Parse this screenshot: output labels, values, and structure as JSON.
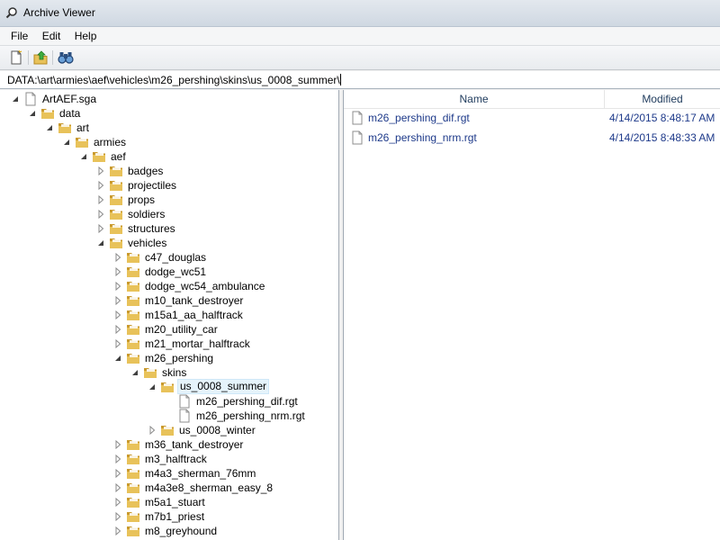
{
  "window": {
    "title": "Archive Viewer"
  },
  "menu": [
    "File",
    "Edit",
    "Help"
  ],
  "toolbar": {
    "buttons": [
      "new-document-icon",
      "extract-icon",
      "find-icon"
    ]
  },
  "path": "DATA:\\art\\armies\\aef\\vehicles\\m26_pershing\\skins\\us_0008_summer\\",
  "tree": [
    {
      "label": "ArtAEF.sga",
      "depth": 0,
      "expander": "expanded",
      "icon": "file"
    },
    {
      "label": "data",
      "depth": 1,
      "expander": "expanded",
      "icon": "folder"
    },
    {
      "label": "art",
      "depth": 2,
      "expander": "expanded",
      "icon": "folder"
    },
    {
      "label": "armies",
      "depth": 3,
      "expander": "expanded",
      "icon": "folder"
    },
    {
      "label": "aef",
      "depth": 4,
      "expander": "expanded",
      "icon": "folder"
    },
    {
      "label": "badges",
      "depth": 5,
      "expander": "collapsed",
      "icon": "folder"
    },
    {
      "label": "projectiles",
      "depth": 5,
      "expander": "collapsed",
      "icon": "folder"
    },
    {
      "label": "props",
      "depth": 5,
      "expander": "collapsed",
      "icon": "folder"
    },
    {
      "label": "soldiers",
      "depth": 5,
      "expander": "collapsed",
      "icon": "folder"
    },
    {
      "label": "structures",
      "depth": 5,
      "expander": "collapsed",
      "icon": "folder"
    },
    {
      "label": "vehicles",
      "depth": 5,
      "expander": "expanded",
      "icon": "folder"
    },
    {
      "label": "c47_douglas",
      "depth": 6,
      "expander": "collapsed",
      "icon": "folder"
    },
    {
      "label": "dodge_wc51",
      "depth": 6,
      "expander": "collapsed",
      "icon": "folder"
    },
    {
      "label": "dodge_wc54_ambulance",
      "depth": 6,
      "expander": "collapsed",
      "icon": "folder"
    },
    {
      "label": "m10_tank_destroyer",
      "depth": 6,
      "expander": "collapsed",
      "icon": "folder"
    },
    {
      "label": "m15a1_aa_halftrack",
      "depth": 6,
      "expander": "collapsed",
      "icon": "folder"
    },
    {
      "label": "m20_utility_car",
      "depth": 6,
      "expander": "collapsed",
      "icon": "folder"
    },
    {
      "label": "m21_mortar_halftrack",
      "depth": 6,
      "expander": "collapsed",
      "icon": "folder"
    },
    {
      "label": "m26_pershing",
      "depth": 6,
      "expander": "expanded",
      "icon": "folder"
    },
    {
      "label": "skins",
      "depth": 7,
      "expander": "expanded",
      "icon": "folder"
    },
    {
      "label": "us_0008_summer",
      "depth": 8,
      "expander": "expanded",
      "icon": "folder",
      "selected": true
    },
    {
      "label": "m26_pershing_dif.rgt",
      "depth": 9,
      "expander": "none",
      "icon": "file"
    },
    {
      "label": "m26_pershing_nrm.rgt",
      "depth": 9,
      "expander": "none",
      "icon": "file"
    },
    {
      "label": "us_0008_winter",
      "depth": 8,
      "expander": "collapsed",
      "icon": "folder"
    },
    {
      "label": "m36_tank_destroyer",
      "depth": 6,
      "expander": "collapsed",
      "icon": "folder"
    },
    {
      "label": "m3_halftrack",
      "depth": 6,
      "expander": "collapsed",
      "icon": "folder"
    },
    {
      "label": "m4a3_sherman_76mm",
      "depth": 6,
      "expander": "collapsed",
      "icon": "folder"
    },
    {
      "label": "m4a3e8_sherman_easy_8",
      "depth": 6,
      "expander": "collapsed",
      "icon": "folder"
    },
    {
      "label": "m5a1_stuart",
      "depth": 6,
      "expander": "collapsed",
      "icon": "folder"
    },
    {
      "label": "m7b1_priest",
      "depth": 6,
      "expander": "collapsed",
      "icon": "folder"
    },
    {
      "label": "m8_greyhound",
      "depth": 6,
      "expander": "collapsed",
      "icon": "folder"
    }
  ],
  "list": {
    "columns": {
      "name": "Name",
      "modified": "Modified"
    },
    "rows": [
      {
        "name": "m26_pershing_dif.rgt",
        "modified": "4/14/2015 8:48:17 AM"
      },
      {
        "name": "m26_pershing_nrm.rgt",
        "modified": "4/14/2015 8:48:33 AM"
      }
    ]
  },
  "colors": {
    "folder": "#e8c25a",
    "folder_dark": "#c99a2e",
    "selection": "#e5f3fb",
    "link_text": "#1e3a8a"
  }
}
